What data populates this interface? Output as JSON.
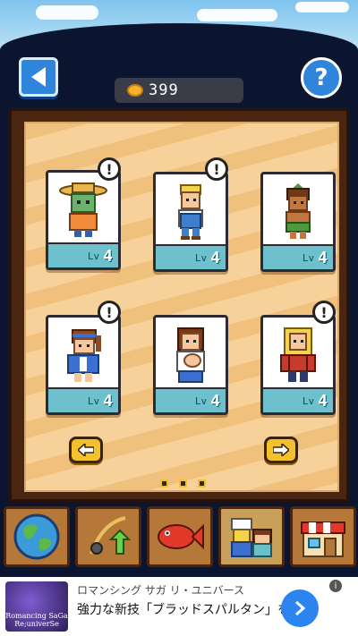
{
  "header": {
    "back_icon": "back-arrow-icon",
    "help_label": "?",
    "coins": "399"
  },
  "cards": [
    {
      "level_tag": "Lv",
      "level": "4",
      "alert": "!",
      "character": "straw-hat-green-cat"
    },
    {
      "level_tag": "Lv",
      "level": "4",
      "alert": "!",
      "character": "blond-boy-blue-overalls"
    },
    {
      "level_tag": "Lv",
      "level": "4",
      "alert": "!",
      "character": "leaf-hair-tan-girl"
    },
    {
      "level_tag": "Lv",
      "level": "4",
      "alert": "!",
      "character": "headband-girl-blue-coat"
    },
    {
      "level_tag": "Lv",
      "level": "4",
      "alert": "!",
      "character": "woman-holding-baby"
    },
    {
      "level_tag": "Lv",
      "level": "4",
      "alert": "!",
      "character": "blond-woman-red-plaid"
    }
  ],
  "pager": {
    "total": 3,
    "current": 1
  },
  "nav": [
    {
      "icon": "globe-icon"
    },
    {
      "icon": "fishing-rod-upgrade-icon"
    },
    {
      "icon": "fish-icon"
    },
    {
      "icon": "characters-icon"
    },
    {
      "icon": "shop-icon"
    }
  ],
  "ad": {
    "logo_text": "Romancing SaGa Re;univerSe",
    "title": "ロマンシング サガ リ・ユニバース",
    "text": "強力な新技「ブラッドスパルタン」を…",
    "info": "i"
  },
  "colors": {
    "accent": "#2f84dc",
    "level_bar": "#6cc1cd",
    "board": "#f6d29a",
    "arrow": "#f3c12c"
  }
}
